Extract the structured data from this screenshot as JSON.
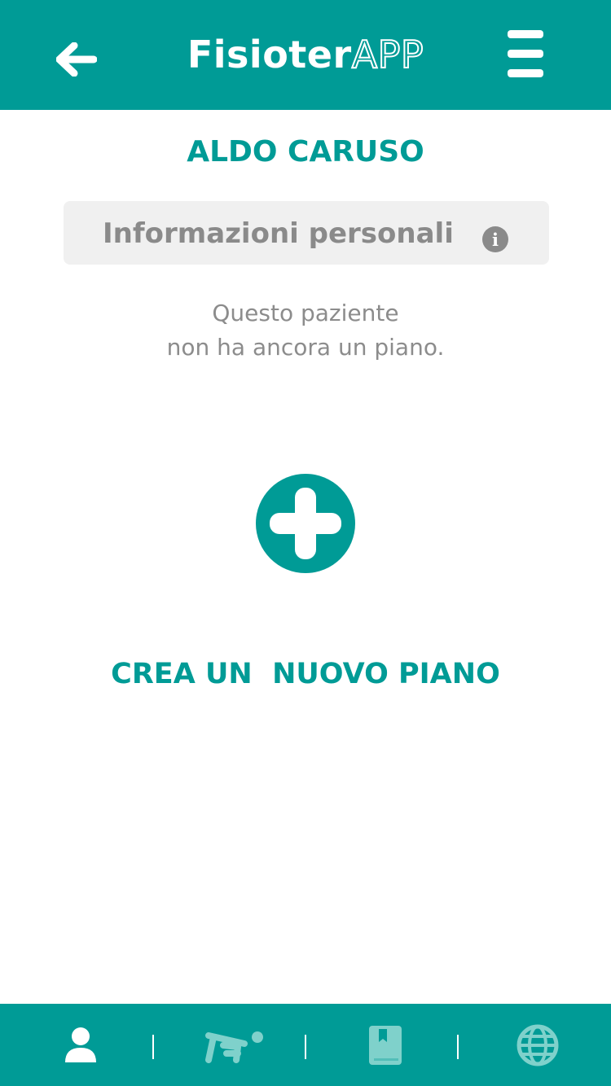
{
  "header": {
    "title_main": "Fisioter",
    "title_accent": "APP",
    "back_icon": "arrow-left-icon",
    "menu_icon": "hamburger-menu-icon"
  },
  "patient": {
    "name": "ALDO CARUSO"
  },
  "personal_info": {
    "label": "Informazioni personali",
    "icon": "info-icon",
    "icon_glyph": "i"
  },
  "empty_state": {
    "line1": "Questo paziente",
    "line2": "non ha ancora un piano."
  },
  "create_plan": {
    "icon": "plus-circle-icon",
    "label": "CREA UN  NUOVO PIANO"
  },
  "bottom_nav": {
    "items": [
      {
        "icon": "user-icon",
        "active": true
      },
      {
        "icon": "exercise-icon",
        "active": false
      },
      {
        "icon": "bookmark-book-icon",
        "active": false
      },
      {
        "icon": "globe-icon",
        "active": false
      }
    ]
  },
  "colors": {
    "primary": "#009b96",
    "inactive_icon": "#7fd1cb",
    "muted_text": "#8c8c8c",
    "info_box_bg": "#f0f0f0"
  }
}
